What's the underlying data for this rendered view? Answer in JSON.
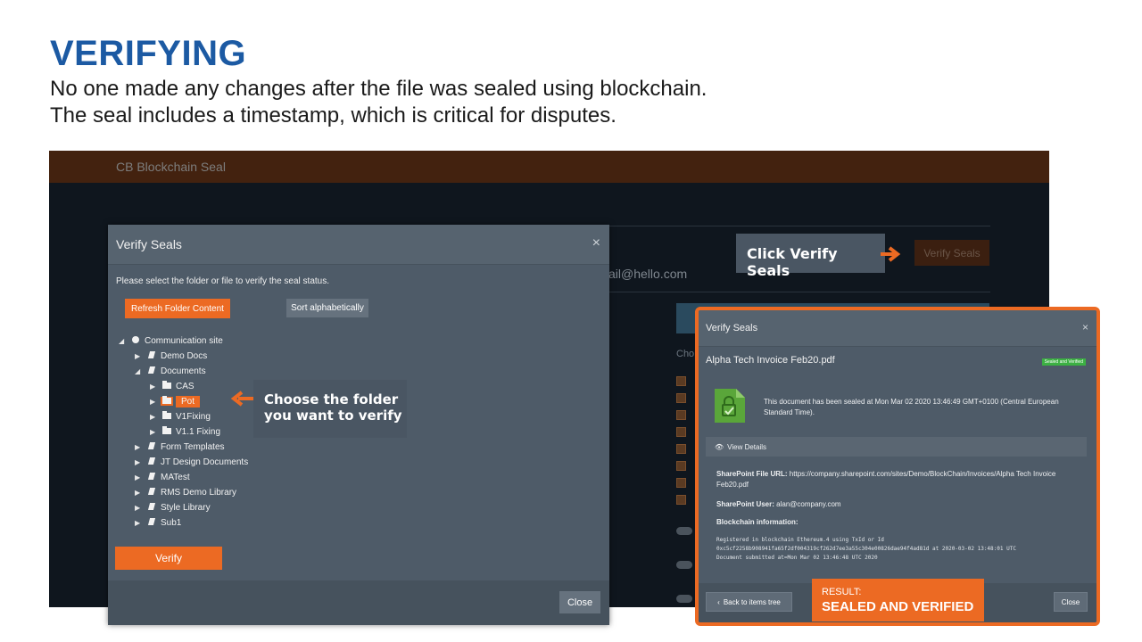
{
  "slide": {
    "title": "VERIFYING",
    "line1": "No one made any changes after the file was sealed using blockchain.",
    "line2": "The seal includes a timestamp, which is critical for disputes."
  },
  "app": {
    "title": "CB Blockchain Seal",
    "email_fragment": "ail@hello.com",
    "verify_seals_button": "Verify Seals",
    "choose_fragment": "Cho"
  },
  "dialog": {
    "title": "Verify Seals",
    "close_icon": "×",
    "instruction": "Please select the folder or file to verify the seal status.",
    "refresh_button": "Refresh Folder Content",
    "sort_button": "Sort alphabetically",
    "verify_button": "Verify",
    "close_button": "Close",
    "tree": [
      {
        "label": "Communication site",
        "icon": "globe-icon"
      },
      {
        "label": "Demo Docs",
        "icon": "library-icon"
      },
      {
        "label": "Documents",
        "icon": "library-icon"
      },
      {
        "label": "CAS",
        "icon": "folder-icon"
      },
      {
        "label": "Pot",
        "icon": "folder-icon",
        "selected": true
      },
      {
        "label": "V1Fixing",
        "icon": "folder-icon"
      },
      {
        "label": "V1.1 Fixing",
        "icon": "folder-icon"
      },
      {
        "label": "Form Templates",
        "icon": "library-icon"
      },
      {
        "label": "JT Design Documents",
        "icon": "library-icon"
      },
      {
        "label": "MATest",
        "icon": "library-icon"
      },
      {
        "label": "RMS Demo Library",
        "icon": "library-icon"
      },
      {
        "label": "Style Library",
        "icon": "library-icon"
      },
      {
        "label": "Sub1",
        "icon": "library-icon"
      }
    ]
  },
  "callouts": {
    "verify": "Click Verify Seals",
    "folder_line1": "Choose the folder",
    "folder_line2": "you want to verify"
  },
  "result": {
    "title": "Verify Seals",
    "close_icon": "×",
    "filename": "Alpha Tech Invoice Feb20.pdf",
    "badge": "Sealed and Verified",
    "sealed_text": "This document has been sealed at Mon Mar 02 2020 13:46:49 GMT+0100 (Central European Standard Time).",
    "view_details": "View Details",
    "url_label": "SharePoint File URL:",
    "url_value": "https://company.sharepoint.com/sites/Demo/BlockChain/Invoices/Alpha Tech Invoice Feb20.pdf",
    "user_label": "SharePoint User:",
    "user_value": "alan@company.com",
    "blockchain_label": "Blockchain information:",
    "bc_line1": "Registered in blockchain Ethereum.4 using TxId or Id",
    "bc_line2": "0xc5cf2258b908941fa65f2df004319cf262d7ee3a55c304e00826dae94f4ad81d at 2020-03-02 13:48:01 UTC",
    "bc_line3": "Document submitted at=Mon Mar 02 13:46:48 UTC 2020",
    "back_button": "Back to items tree",
    "close_button": "Close",
    "result_small": "RESULT:",
    "result_big": "SEALED AND VERIFIED"
  },
  "colors": {
    "title_blue": "#1c5aa3",
    "accent_orange": "#ec6a23",
    "dialog_bg": "#4e5b68",
    "verified_green": "#3cb043"
  }
}
